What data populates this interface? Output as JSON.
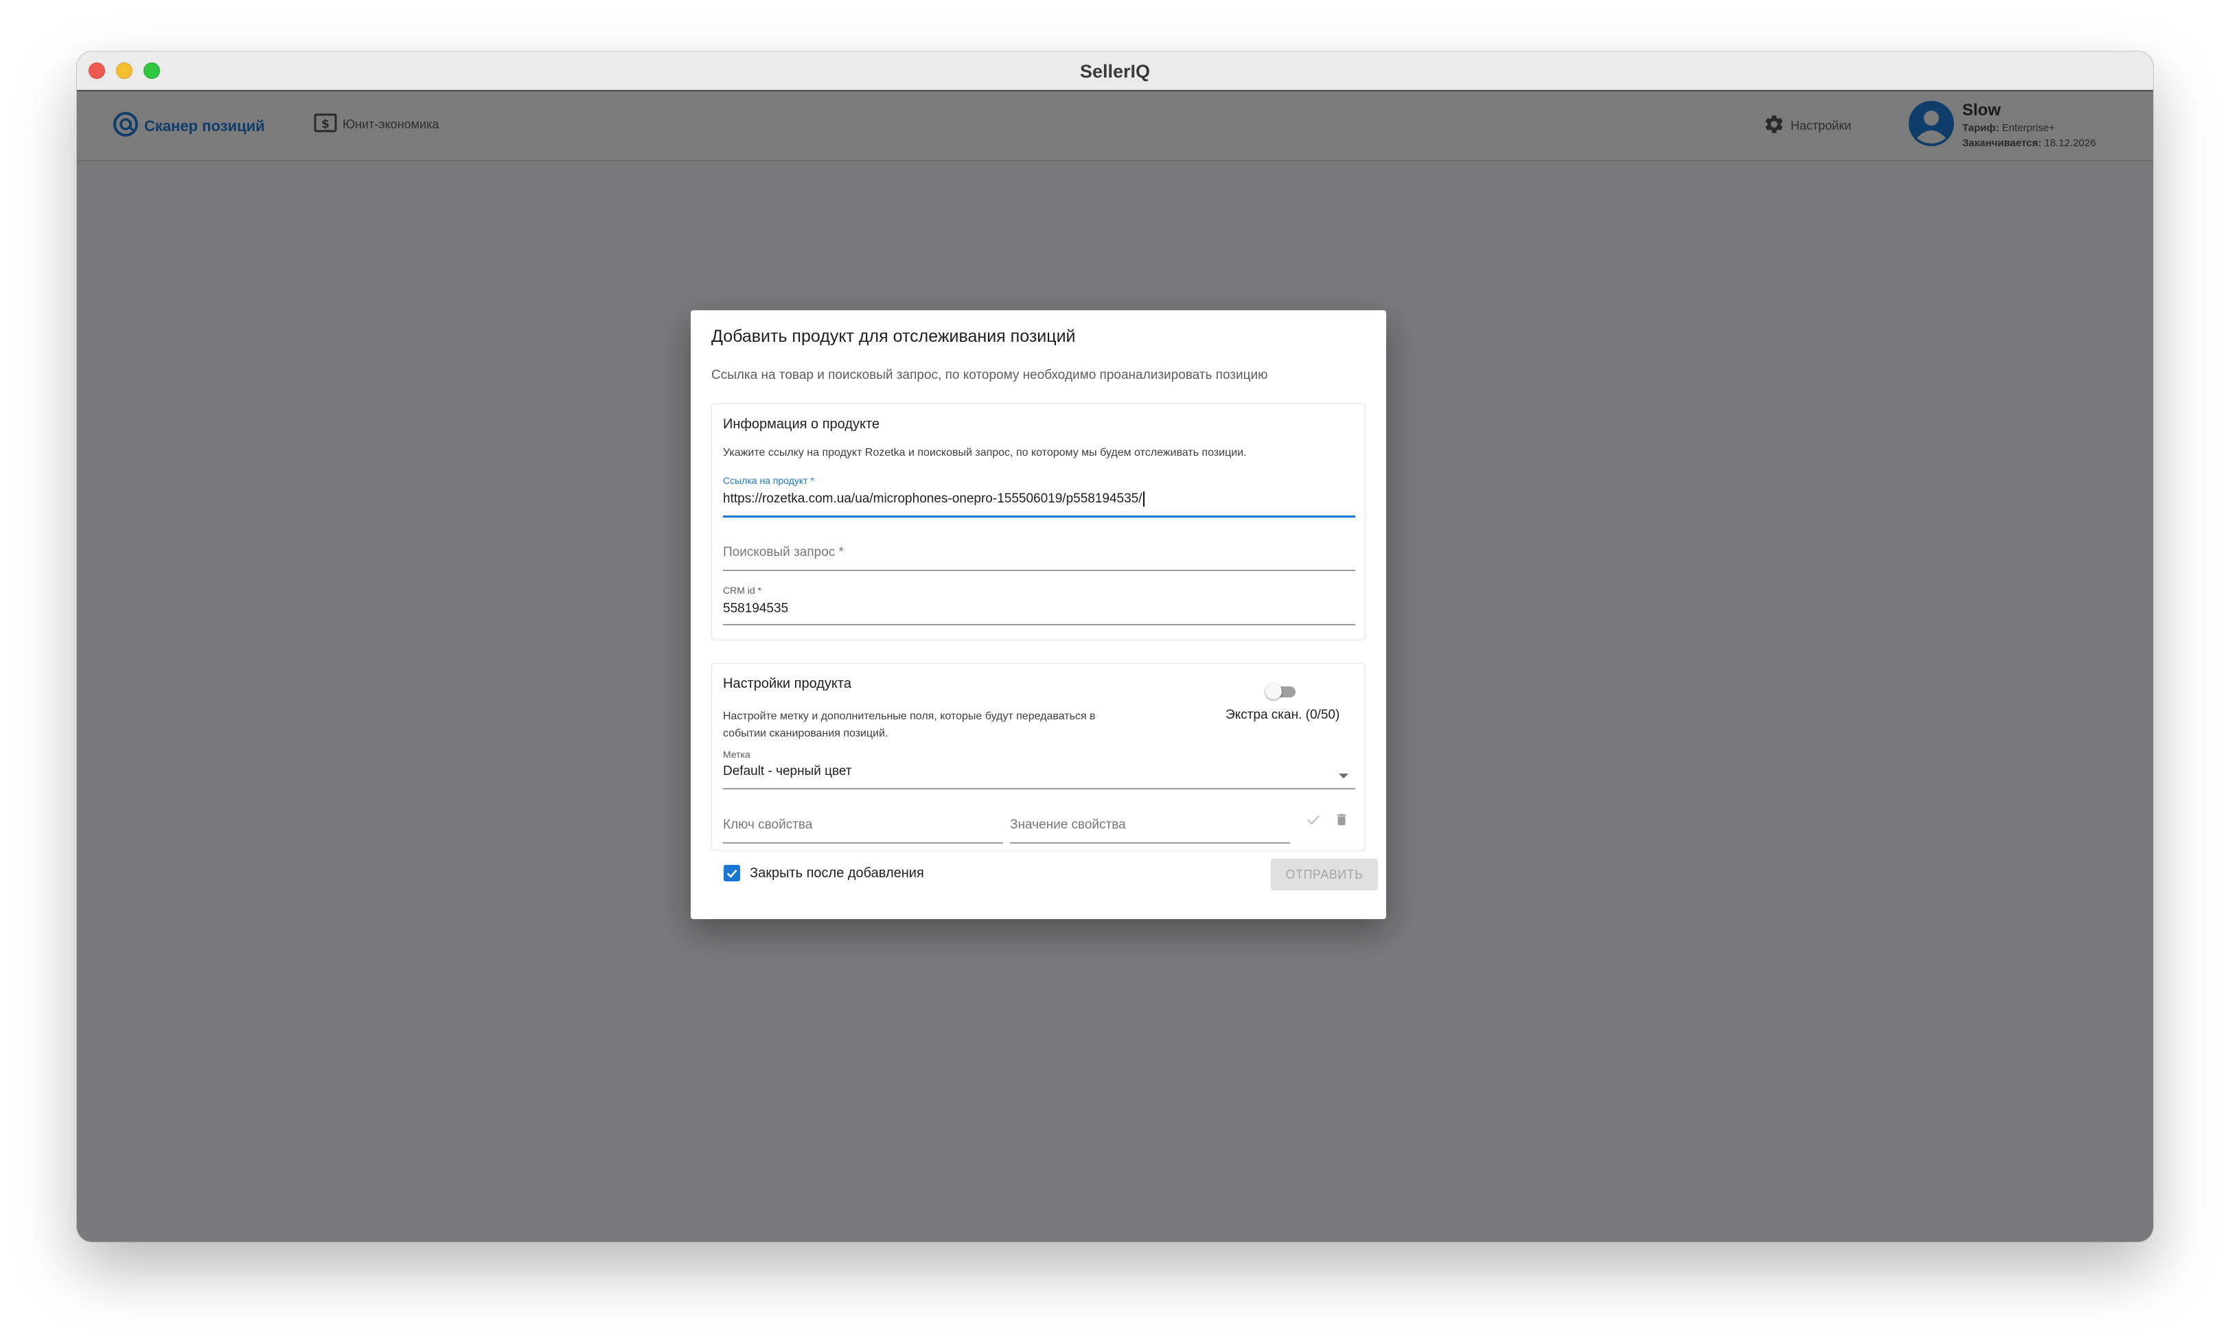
{
  "window": {
    "title": "SellerIQ"
  },
  "nav": {
    "scanner_label": "Сканер позиций",
    "unit_label": "Юнит-экономика",
    "settings_label": "Настройки"
  },
  "user": {
    "name": "Slow",
    "plan_key": "Тариф:",
    "plan_value": "Enterprise+",
    "expires_key": "Заканчивается:",
    "expires_value": "18.12.2026"
  },
  "dialog": {
    "title": "Добавить продукт для отслеживания позиций",
    "subtitle": "Ссылка на товар и поисковый запрос, по которому необходимо проанализировать позицию",
    "product_info": {
      "title": "Информация о продукте",
      "description": "Укажите ссылку на продукт Rozetka и поисковый запрос, по которому мы будем отслеживать позиции.",
      "link_label": "Ссылка на продукт *",
      "link_value": "https://rozetka.com.ua/ua/microphones-onepro-155506019/p558194535/",
      "query_placeholder": "Поисковый запрос *",
      "crm_label": "CRM id *",
      "crm_value": "558194535"
    },
    "product_settings": {
      "title": "Настройки продукта",
      "description_line1": "Настройте метку и дополнительные поля, которые будут передаваться в",
      "description_line2": "событии сканирования позиций.",
      "extra_scan_label": "Экстра скан. (0/50)",
      "extra_scan_enabled": false,
      "tag_label": "Метка",
      "tag_value": "Default - черный цвет",
      "property_key_placeholder": "Ключ свойства",
      "property_value_placeholder": "Значение свойства"
    },
    "close_after_add_label": "Закрыть после добавления",
    "close_after_add_checked": true,
    "submit_label": "ОТПРАВИТЬ"
  },
  "colors": {
    "accent": "#1976d2",
    "brand_dark": "#0f3d6a",
    "overlay": "#7a7a7c"
  },
  "icons": {
    "scanner": "at-sign-icon",
    "unit": "dollar-box-icon",
    "settings": "gear-icon",
    "avatar": "account-circle-icon",
    "confirm": "check-icon",
    "delete": "trash-icon",
    "dropdown": "chevron-down-icon",
    "checkbox": "checkmark-icon"
  }
}
